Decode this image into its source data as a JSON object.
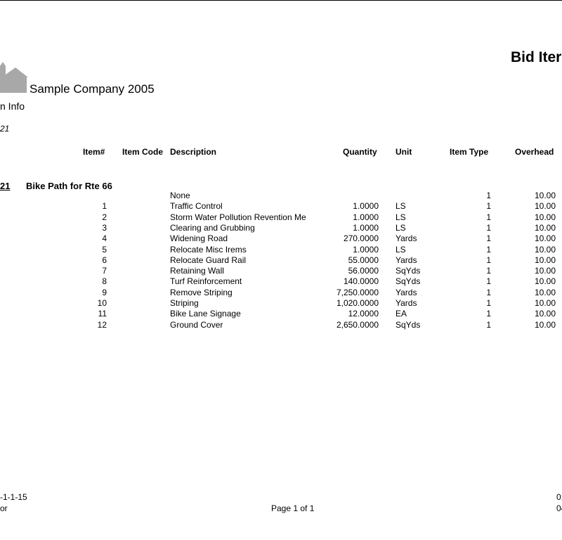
{
  "report": {
    "title": "Bid Iter",
    "company": "Sample Company 2005",
    "subtitle": "n Info",
    "id_line": "21"
  },
  "columns": {
    "item_no": "Item#",
    "item_code": "Item Code",
    "description": "Description",
    "quantity": "Quantity",
    "unit": "Unit",
    "item_type": "Item Type",
    "overhead": "Overhead"
  },
  "group": {
    "number": "21",
    "name": "Bike Path for Rte 66"
  },
  "rows": [
    {
      "item": "",
      "desc": "None",
      "qty": "",
      "unit": "",
      "type": "1",
      "oh": "10.00"
    },
    {
      "item": "1",
      "desc": "Traffic Control",
      "qty": "1.0000",
      "unit": "LS",
      "type": "1",
      "oh": "10.00"
    },
    {
      "item": "2",
      "desc": "Storm Water Pollution Revention Me",
      "qty": "1.0000",
      "unit": "LS",
      "type": "1",
      "oh": "10.00"
    },
    {
      "item": "3",
      "desc": "Clearing and Grubbing",
      "qty": "1.0000",
      "unit": "LS",
      "type": "1",
      "oh": "10.00"
    },
    {
      "item": "4",
      "desc": "Widening Road",
      "qty": "270.0000",
      "unit": "Yards",
      "type": "1",
      "oh": "10.00"
    },
    {
      "item": "5",
      "desc": "Relocate Misc Irems",
      "qty": "1.0000",
      "unit": "LS",
      "type": "1",
      "oh": "10.00"
    },
    {
      "item": "6",
      "desc": "Relocate Guard Rail",
      "qty": "55.0000",
      "unit": "Yards",
      "type": "1",
      "oh": "10.00"
    },
    {
      "item": "7",
      "desc": "Retaining Wall",
      "qty": "56.0000",
      "unit": "SqYds",
      "type": "1",
      "oh": "10.00"
    },
    {
      "item": "8",
      "desc": "Turf Reinforcement",
      "qty": "140.0000",
      "unit": "SqYds",
      "type": "1",
      "oh": "10.00"
    },
    {
      "item": "9",
      "desc": "Remove Striping",
      "qty": "7,250.0000",
      "unit": "Yards",
      "type": "1",
      "oh": "10.00"
    },
    {
      "item": "10",
      "desc": "Striping",
      "qty": "1,020.0000",
      "unit": "Yards",
      "type": "1",
      "oh": "10.00"
    },
    {
      "item": "11",
      "desc": "Bike Lane Signage",
      "qty": "12.0000",
      "unit": "EA",
      "type": "1",
      "oh": "10.00"
    },
    {
      "item": "12",
      "desc": "Ground Cover",
      "qty": "2,650.0000",
      "unit": "SqYds",
      "type": "1",
      "oh": "10.00"
    }
  ],
  "footer": {
    "left1": "-1-1-15",
    "left2": "or",
    "page": "Page 1 of 1",
    "right1": "0:",
    "right2": "04"
  }
}
